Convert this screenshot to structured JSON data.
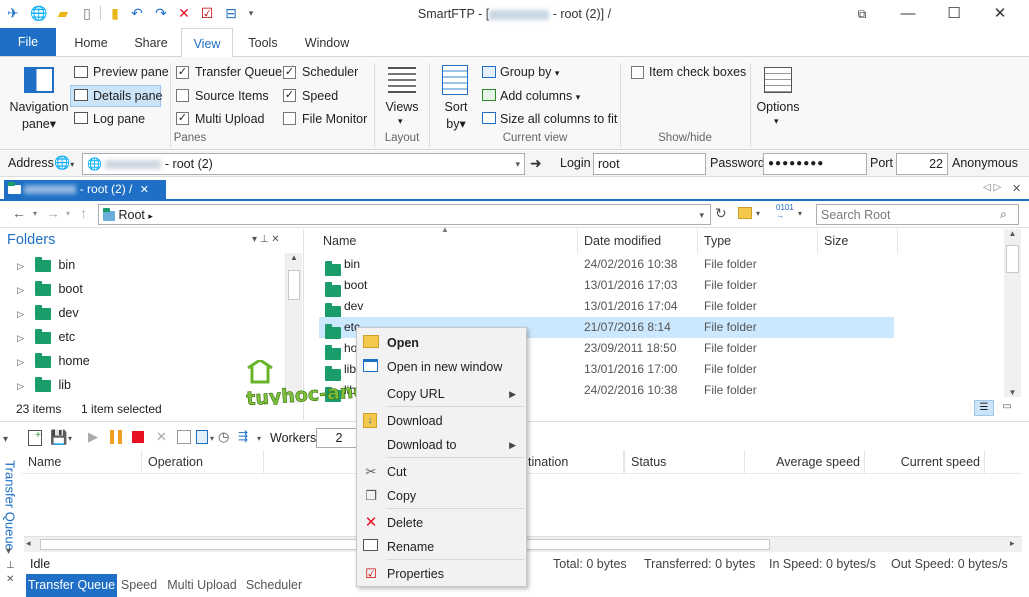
{
  "window": {
    "title": "SmartFTP - [",
    "title_suffix": "- root (2)] /"
  },
  "tabs": {
    "file": "File",
    "home": "Home",
    "share": "Share",
    "view": "View",
    "tools": "Tools",
    "window": "Window"
  },
  "ribbon": {
    "navigation_pane": "Navigation",
    "navigation_pane2": "pane",
    "preview_pane": "Preview pane",
    "details_pane": "Details pane",
    "log_pane": "Log pane",
    "transfer_queue": "Transfer Queue",
    "source_items": "Source Items",
    "multi_upload": "Multi Upload",
    "scheduler": "Scheduler",
    "speed": "Speed",
    "file_monitor": "File Monitor",
    "panes_group": "Panes",
    "views": "Views",
    "layout_group": "Layout",
    "sort": "Sort",
    "sort_by": "by",
    "group_by": "Group by",
    "add_columns": "Add columns",
    "size_all_columns": "Size all columns to fit",
    "current_view_group": "Current view",
    "item_check_boxes": "Item check boxes",
    "show_hide_group": "Show/hide",
    "options": "Options"
  },
  "address": {
    "label": "Address",
    "value": "- root (2)",
    "login_label": "Login",
    "login_value": "root",
    "password_label": "Password",
    "password_value": "●●●●●●●●",
    "port_label": "Port",
    "port_value": "22",
    "anonymous_label": "Anonymous"
  },
  "doc_tab": {
    "label": "- root (2) /"
  },
  "nav": {
    "root": "Root",
    "search_placeholder": "Search Root"
  },
  "folders": {
    "title": "Folders",
    "items": [
      "bin",
      "boot",
      "dev",
      "etc",
      "home",
      "lib"
    ],
    "status_count": "23 items",
    "status_selected": "1 item selected"
  },
  "columns": {
    "name": "Name",
    "date_modified": "Date modified",
    "type": "Type",
    "size": "Size"
  },
  "files": [
    {
      "name": "bin",
      "date": "24/02/2016 10:38",
      "type": "File folder"
    },
    {
      "name": "boot",
      "date": "13/01/2016 17:03",
      "type": "File folder"
    },
    {
      "name": "dev",
      "date": "13/01/2016 17:04",
      "type": "File folder"
    },
    {
      "name": "etc",
      "date": "21/07/2016 8:14",
      "type": "File folder"
    },
    {
      "name": "ho",
      "date": "23/09/2011 18:50",
      "type": "File folder"
    },
    {
      "name": "lib",
      "date": "13/01/2016 17:00",
      "type": "File folder"
    },
    {
      "name": "lib",
      "date": "24/02/2016 10:38",
      "type": "File folder"
    }
  ],
  "queue": {
    "side_label": "Transfer Queue",
    "workers_label": "Workers",
    "workers_value": "2",
    "col_name": "Name",
    "col_operation": "Operation",
    "col_destination": "tination",
    "col_status": "Status",
    "col_avg_speed": "Average speed",
    "col_cur_speed": "Current speed",
    "idle": "Idle",
    "total": "Total: 0 bytes",
    "transferred": "Transferred: 0 bytes",
    "in_speed": "In Speed: 0 bytes/s",
    "out_speed": "Out Speed: 0 bytes/s"
  },
  "bottom_tabs": [
    "Transfer Queue",
    "Speed",
    "Multi Upload",
    "Scheduler"
  ],
  "context_menu": {
    "open": "Open",
    "open_new_window": "Open in new window",
    "copy_url": "Copy URL",
    "download": "Download",
    "download_to": "Download to",
    "cut": "Cut",
    "copy": "Copy",
    "delete": "Delete",
    "rename": "Rename",
    "properties": "Properties"
  },
  "watermark": "tuyhoc-android19",
  "colors": {
    "accent": "#1e6fc5",
    "folder": "#1a9d6a",
    "selection": "#cce8ff",
    "delete": "#e81123"
  }
}
